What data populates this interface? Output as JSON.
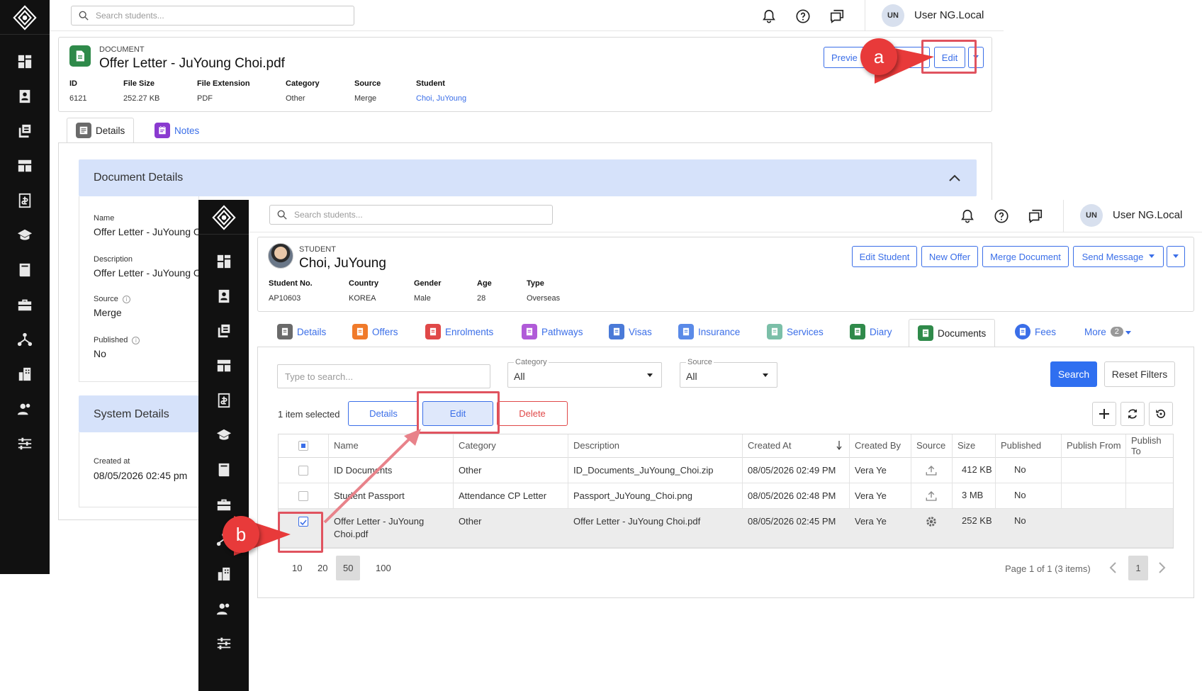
{
  "bg": {
    "search_placeholder": "Search students...",
    "user_initials": "UN",
    "user_name": "User NG.Local",
    "doc_type": "DOCUMENT",
    "doc_title": "Offer Letter - JuYoung Choi.pdf",
    "buttons": {
      "preview": "Previe",
      "download": "oad",
      "edit": "Edit"
    },
    "fields": [
      {
        "label": "ID",
        "value": "6121"
      },
      {
        "label": "File Size",
        "value": "252.27 KB"
      },
      {
        "label": "File Extension",
        "value": "PDF"
      },
      {
        "label": "Category",
        "value": "Other"
      },
      {
        "label": "Source",
        "value": "Merge"
      },
      {
        "label": "Student",
        "value": "Choi, JuYoung"
      }
    ],
    "tabs": {
      "details": "Details",
      "notes": "Notes"
    },
    "section_document": "Document Details",
    "details": [
      {
        "label": "Name",
        "value": "Offer Letter - JuYoung C"
      },
      {
        "label": "Description",
        "value": "Offer Letter - JuYoung C"
      },
      {
        "label": "Source",
        "value": "Merge"
      },
      {
        "label": "Published",
        "value": "No"
      }
    ],
    "section_system": "System Details",
    "created_label": "Created at",
    "created_value": "08/05/2026 02:45 pm"
  },
  "fg": {
    "search_placeholder": "Search students...",
    "user_initials": "UN",
    "user_name": "User NG.Local",
    "student_type": "STUDENT",
    "student_name": "Choi, JuYoung",
    "buttons": {
      "edit_student": "Edit Student",
      "new_offer": "New Offer",
      "merge_document": "Merge Document",
      "send_message": "Send Message"
    },
    "fields": [
      {
        "label": "Student No.",
        "value": "AP10603"
      },
      {
        "label": "Country",
        "value": "KOREA"
      },
      {
        "label": "Gender",
        "value": "Male"
      },
      {
        "label": "Age",
        "value": "28"
      },
      {
        "label": "Type",
        "value": "Overseas"
      }
    ],
    "tabs": [
      "Details",
      "Offers",
      "Enrolments",
      "Pathways",
      "Visas",
      "Insurance",
      "Services",
      "Diary",
      "Documents",
      "Fees"
    ],
    "tab_colors": [
      "#6a6a6a",
      "#f07a2a",
      "#e04848",
      "#b05ad8",
      "#4a7ad8",
      "#5a8ae8",
      "#7bbfa8",
      "#2f8a4a",
      "#2f8a4a",
      "#3a6ee8"
    ],
    "more_label": "More",
    "more_count": "2",
    "filter": {
      "search_placeholder": "Type to search...",
      "category_label": "Category",
      "category_value": "All",
      "source_label": "Source",
      "source_value": "All",
      "search_button": "Search",
      "reset_button": "Reset Filters"
    },
    "selected_text": "1 item selected",
    "actions": {
      "details": "Details",
      "edit": "Edit",
      "delete": "Delete"
    },
    "columns": [
      "Name",
      "Category",
      "Description",
      "Created At",
      "Created By",
      "Source",
      "Size",
      "Published",
      "Publish From",
      "Publish To"
    ],
    "rows": [
      {
        "name": "ID Documents",
        "category": "Other",
        "description": "ID_Documents_JuYoung_Choi.zip",
        "created_at": "08/05/2026 02:49 PM",
        "created_by": "Vera Ye",
        "size": "412 KB",
        "published": "No"
      },
      {
        "name": "Student Passport",
        "category": "Attendance CP Letter",
        "description": "Passport_JuYoung_Choi.png",
        "created_at": "08/05/2026 02:48 PM",
        "created_by": "Vera Ye",
        "size": "3 MB",
        "published": "No"
      },
      {
        "name": "Offer Letter - JuYoung Choi.pdf",
        "category": "Other",
        "description": "Offer Letter - JuYoung Choi.pdf",
        "created_at": "08/05/2026 02:45 PM",
        "created_by": "Vera Ye",
        "size": "252 KB",
        "published": "No"
      }
    ],
    "page_sizes": [
      "10",
      "20",
      "50",
      "100"
    ],
    "page_info": "Page 1 of 1 (3 items)",
    "current_page": "1"
  },
  "callouts": {
    "a": "a",
    "b": "b"
  }
}
